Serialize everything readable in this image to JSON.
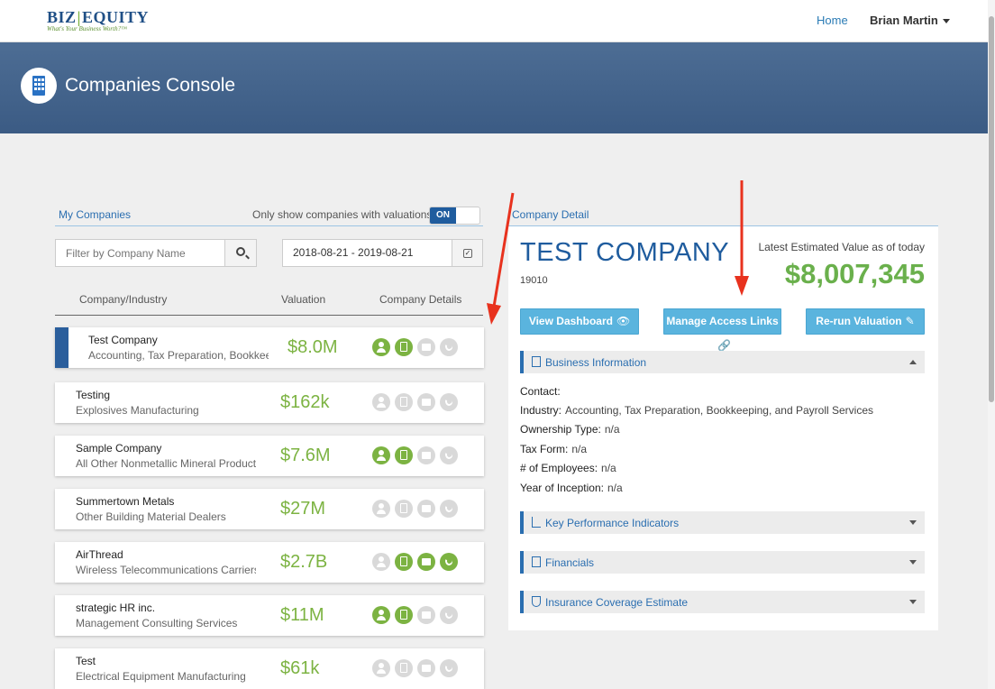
{
  "brand": {
    "name_left": "BIZ",
    "name_right": "EQUITY",
    "tagline": "What's Your Business Worth?™"
  },
  "nav": {
    "home": "Home",
    "user": "Brian Martin"
  },
  "banner": {
    "title": "Companies Console"
  },
  "left": {
    "section_label": "My Companies",
    "only_show_label": "Only show companies with valuations",
    "toggle_state": "ON",
    "filter_placeholder": "Filter by Company Name",
    "date_range": "2018-08-21 - 2019-08-21",
    "columns": {
      "company": "Company/Industry",
      "valuation": "Valuation",
      "details": "Company Details"
    },
    "companies": [
      {
        "name": "Test Company",
        "industry": "Accounting, Tax Preparation, Bookkeeping, and Payroll Services",
        "valuation": "$8.0M",
        "selected": true,
        "icons": [
          true,
          true,
          false,
          false
        ]
      },
      {
        "name": "Testing",
        "industry": "Explosives Manufacturing",
        "valuation": "$162k",
        "selected": false,
        "icons": [
          false,
          false,
          false,
          false
        ]
      },
      {
        "name": "Sample Company",
        "industry": "All Other Nonmetallic Mineral Product Manufacturing",
        "valuation": "$7.6M",
        "selected": false,
        "icons": [
          true,
          true,
          false,
          false
        ]
      },
      {
        "name": "Summertown Metals",
        "industry": "Other Building Material Dealers",
        "valuation": "$27M",
        "selected": false,
        "icons": [
          false,
          false,
          false,
          false
        ]
      },
      {
        "name": "AirThread",
        "industry": "Wireless Telecommunications Carriers (except Satellite)",
        "valuation": "$2.7B",
        "selected": false,
        "icons": [
          false,
          true,
          true,
          true
        ]
      },
      {
        "name": "strategic HR inc.",
        "industry": "Management Consulting Services",
        "valuation": "$11M",
        "selected": false,
        "icons": [
          true,
          true,
          false,
          false
        ]
      },
      {
        "name": "Test",
        "industry": "Electrical Equipment Manufacturing",
        "valuation": "$61k",
        "selected": false,
        "icons": [
          false,
          false,
          false,
          false
        ]
      }
    ]
  },
  "detail": {
    "section_label": "Company Detail",
    "company_name": "TEST COMPANY",
    "company_id": "19010",
    "latest_value_label": "Latest Estimated Value as of today",
    "latest_value": "$8,007,345",
    "buttons": {
      "dashboard": "View Dashboard",
      "access_links": "Manage Access Links",
      "rerun": "Re-run Valuation"
    },
    "business_info_title": "Business Information",
    "fields": [
      {
        "label": "Contact:",
        "value": ""
      },
      {
        "label": "Industry:",
        "value": "Accounting, Tax Preparation, Bookkeeping, and Payroll Services"
      },
      {
        "label": "Ownership Type:",
        "value": "n/a"
      },
      {
        "label": "Tax Form:",
        "value": "n/a"
      },
      {
        "label": "# of Employees:",
        "value": "n/a"
      },
      {
        "label": "Year of Inception:",
        "value": "n/a"
      }
    ],
    "sections": [
      "Key Performance Indicators",
      "Financials",
      "Insurance Coverage Estimate"
    ]
  },
  "colors": {
    "accent": "#1f5c9e",
    "valuation_green": "#7cb342",
    "button_blue": "#5ab4de",
    "arrow_red": "#e8321e"
  }
}
